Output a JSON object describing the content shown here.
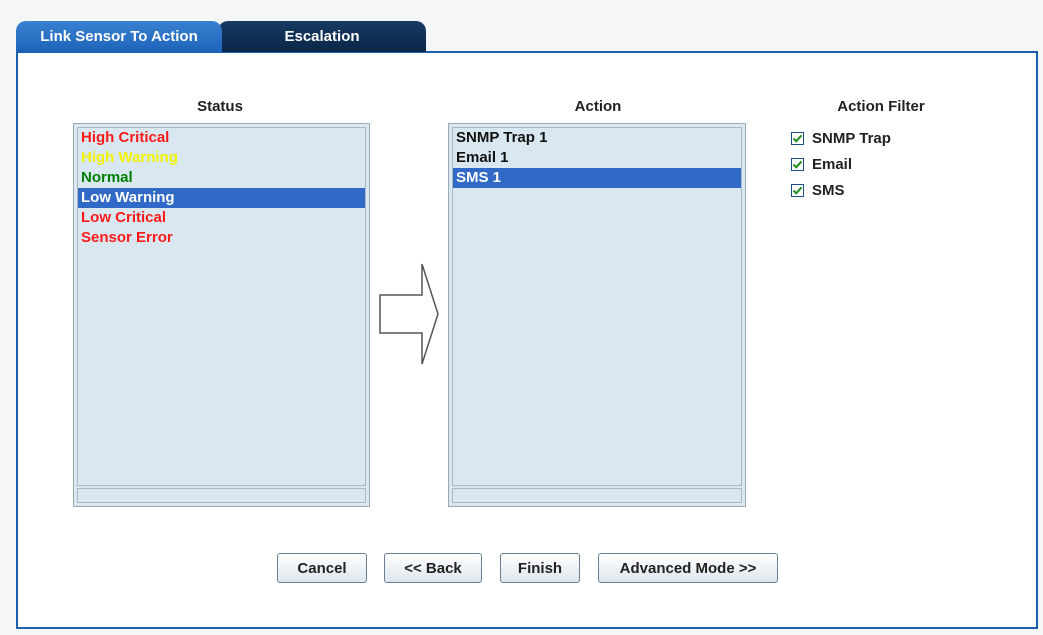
{
  "tabs": [
    {
      "label": "Link Sensor To Action",
      "active": true
    },
    {
      "label": "Escalation",
      "active": false
    }
  ],
  "status_column": {
    "label": "Status",
    "items": [
      {
        "label": "High Critical",
        "color": "#ff1a1a"
      },
      {
        "label": "High Warning",
        "color": "#f2f200"
      },
      {
        "label": "Normal",
        "color": "#008000"
      },
      {
        "label": "Low Warning",
        "color": "#ffffff",
        "selected": true
      },
      {
        "label": "Low Critical",
        "color": "#ff1a1a"
      },
      {
        "label": "Sensor Error",
        "color": "#ff1a1a"
      }
    ]
  },
  "action_column": {
    "label": "Action",
    "items": [
      {
        "label": "SNMP Trap 1"
      },
      {
        "label": "Email 1"
      },
      {
        "label": "SMS 1",
        "selected": true
      }
    ]
  },
  "action_filter": {
    "label": "Action Filter",
    "options": [
      {
        "label": "SNMP Trap",
        "checked": true
      },
      {
        "label": "Email",
        "checked": true
      },
      {
        "label": "SMS",
        "checked": true
      }
    ]
  },
  "buttons": {
    "cancel": "Cancel",
    "back": "<< Back",
    "finish": "Finish",
    "advanced": "Advanced Mode >>"
  },
  "colors": {
    "accent": "#1c5fb0",
    "selection": "#3169c6",
    "list_background": "#d9e8f0"
  },
  "icons": {
    "arrow": "right-arrow-icon",
    "check": "checkmark-icon"
  }
}
